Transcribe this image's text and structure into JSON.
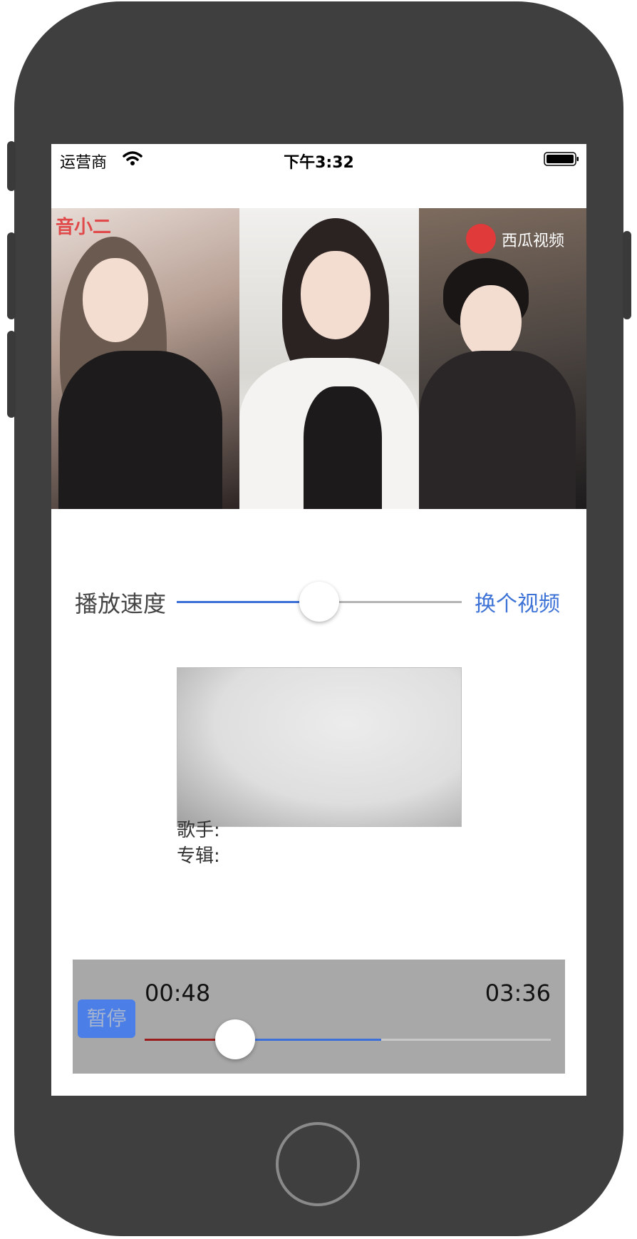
{
  "status_bar": {
    "carrier": "运营商",
    "time": "下午3:32",
    "wifi_icon": "wifi-icon",
    "battery_icon": "battery-icon"
  },
  "banner": {
    "left_logo": "音小二",
    "right_logo": "西瓜视频"
  },
  "speed": {
    "label": "播放速度",
    "value": 0.5,
    "switch_label": "换个视频"
  },
  "track": {
    "artist_label": "歌手:",
    "album_label": "专辑:"
  },
  "player": {
    "pause_label": "暂停",
    "current_time": "00:48",
    "total_time": "03:36",
    "played_fraction": 0.222,
    "buffered_fraction": 0.583
  },
  "colors": {
    "accent": "#3c70d8",
    "played": "#9a1c1c",
    "player_bg": "#a8a8a8",
    "phone_body": "#3f3f3f"
  }
}
